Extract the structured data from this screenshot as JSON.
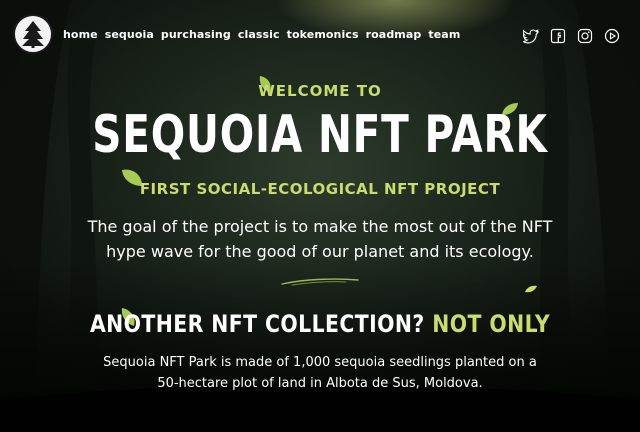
{
  "nav": {
    "items": [
      "home",
      "sequoia",
      "purchasing",
      "classic",
      "tokemonics",
      "roadmap",
      "team"
    ],
    "social_icons": [
      "twitter-icon",
      "facebook-icon",
      "instagram-icon",
      "youtube-icon"
    ]
  },
  "hero": {
    "welcome": "WELCOME TO",
    "title": "SEQUOIA NFT PARK",
    "tagline": "FIRST SOCIAL-ECOLOGICAL NFT PROJECT",
    "goal": "The goal of the project is to make the most out of the NFT hype wave for the good of our planet and its ecology."
  },
  "section": {
    "heading_white": "ANOTHER NFT COLLECTION?",
    "heading_green": "NOT ONLY",
    "description": "Sequoia NFT Park is made of 1,000 sequoia seedlings planted on a 50-hectare plot of land in Albota de Sus, Moldova."
  },
  "colors": {
    "accent": "#c9dc6e",
    "text": "#ffffff",
    "background": "#1d271d"
  }
}
